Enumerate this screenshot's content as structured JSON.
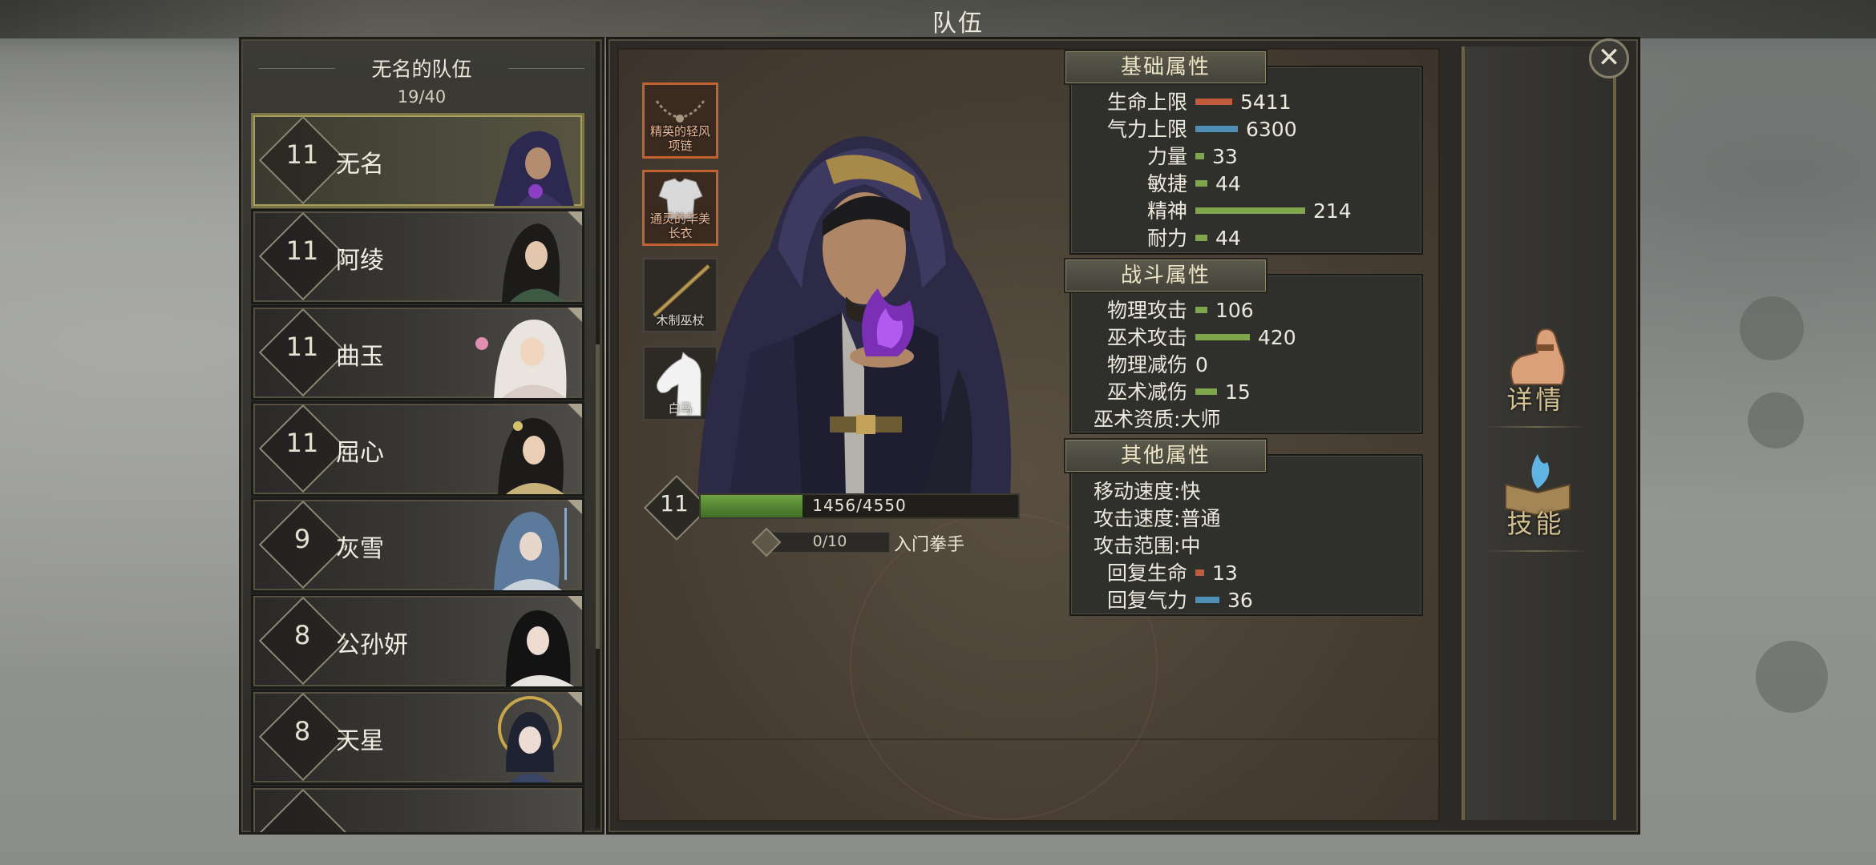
{
  "window": {
    "title": "队伍"
  },
  "team": {
    "name": "无名的队伍",
    "count": "19/40"
  },
  "members": [
    {
      "level": "11",
      "name": "无名"
    },
    {
      "level": "11",
      "name": "阿绫"
    },
    {
      "level": "11",
      "name": "曲玉"
    },
    {
      "level": "11",
      "name": "屈心"
    },
    {
      "level": "9",
      "name": "灰雪"
    },
    {
      "level": "8",
      "name": "公孙妍"
    },
    {
      "level": "8",
      "name": "天星"
    }
  ],
  "equipment": [
    {
      "label": "精英的轻风项链",
      "icon": "necklace-icon"
    },
    {
      "label": "通灵的华美长衣",
      "icon": "robe-icon"
    },
    {
      "label": "木制巫杖",
      "icon": "staff-icon"
    },
    {
      "label": "白马",
      "icon": "horse-icon"
    }
  ],
  "hero": {
    "level": "11",
    "xp_text": "1456/4550",
    "xp_fraction": 0.32,
    "rank_text": "0/10",
    "rank_name": "入门拳手"
  },
  "stats": {
    "basic": {
      "title": "基础属性",
      "rows": [
        {
          "label": "生命上限",
          "value": "5411",
          "bar_fraction": 0.12,
          "color": "#c25a3c"
        },
        {
          "label": "气力上限",
          "value": "6300",
          "bar_fraction": 0.14,
          "color": "#4f8fb6"
        },
        {
          "label": "力量",
          "value": "33",
          "bar_fraction": 0.03,
          "color": "#7fa64a"
        },
        {
          "label": "敏捷",
          "value": "44",
          "bar_fraction": 0.04,
          "color": "#7fa64a"
        },
        {
          "label": "精神",
          "value": "214",
          "bar_fraction": 0.36,
          "color": "#7fa64a"
        },
        {
          "label": "耐力",
          "value": "44",
          "bar_fraction": 0.04,
          "color": "#7fa64a"
        }
      ]
    },
    "combat": {
      "title": "战斗属性",
      "rows": [
        {
          "label": "物理攻击",
          "value": "106",
          "bar_fraction": 0.04,
          "color": "#7fa64a"
        },
        {
          "label": "巫术攻击",
          "value": "420",
          "bar_fraction": 0.18,
          "color": "#7fa64a"
        },
        {
          "label": "物理减伤",
          "value": "0",
          "bar_fraction": 0,
          "color": "#7fa64a"
        },
        {
          "label": "巫术减伤",
          "value": "15",
          "bar_fraction": 0.07,
          "color": "#7fa64a"
        },
        {
          "label": "巫术资质",
          "value": ":大师"
        }
      ]
    },
    "other": {
      "title": "其他属性",
      "rows": [
        {
          "label": "移动速度",
          "value": ":快"
        },
        {
          "label": "攻击速度",
          "value": ":普通"
        },
        {
          "label": "攻击范围",
          "value": ":中"
        },
        {
          "label": "回复生命",
          "value": "13",
          "bar_fraction": 0.03,
          "color": "#c25a3c"
        },
        {
          "label": "回复气力",
          "value": "36",
          "bar_fraction": 0.08,
          "color": "#4f8fb6"
        }
      ]
    }
  },
  "tabs": [
    {
      "label": "详情",
      "icon": "arm-icon"
    },
    {
      "label": "技能",
      "icon": "skillbook-icon"
    }
  ],
  "close": {
    "label": "✕"
  }
}
